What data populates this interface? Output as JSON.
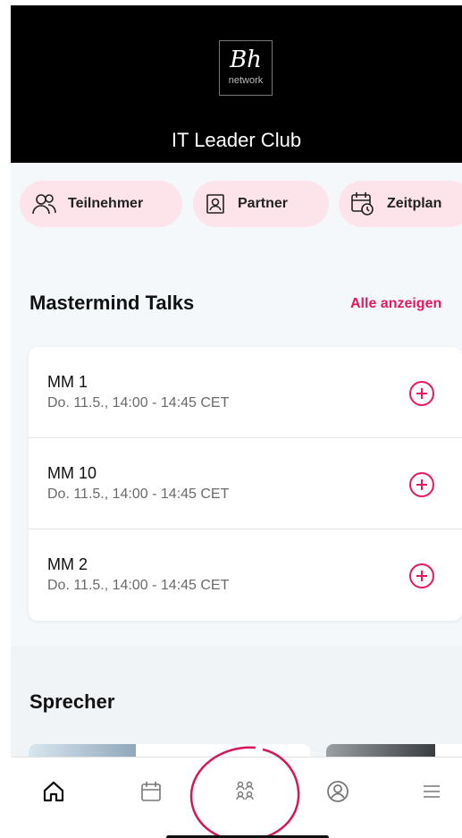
{
  "header": {
    "logo_mark": "Bh",
    "logo_sub": "network",
    "title": "IT Leader Club"
  },
  "pills": [
    {
      "label": "Teilnehmer",
      "icon": "people-icon"
    },
    {
      "label": "Partner",
      "icon": "badge-icon"
    },
    {
      "label": "Zeitplan",
      "icon": "calendar-clock-icon"
    }
  ],
  "mastermind": {
    "title": "Mastermind Talks",
    "see_all": "Alle anzeigen",
    "talks": [
      {
        "name": "MM 1",
        "time": "Do. 11.5., 14:00 - 14:45 CET"
      },
      {
        "name": "MM 10",
        "time": "Do. 11.5., 14:00 - 14:45 CET"
      },
      {
        "name": "MM 2",
        "time": "Do. 11.5., 14:00 - 14:45 CET"
      }
    ]
  },
  "speakers": {
    "title": "Sprecher"
  },
  "tabbar": {
    "items": [
      {
        "icon": "home-icon",
        "active": true
      },
      {
        "icon": "calendar-icon",
        "active": false
      },
      {
        "icon": "attendees-icon",
        "active": false,
        "highlighted": true
      },
      {
        "icon": "profile-icon",
        "active": false
      },
      {
        "icon": "menu-icon",
        "active": false
      }
    ]
  },
  "colors": {
    "accent": "#e8185d",
    "pill_bg": "#fde4ea",
    "header_bg": "#000000"
  }
}
